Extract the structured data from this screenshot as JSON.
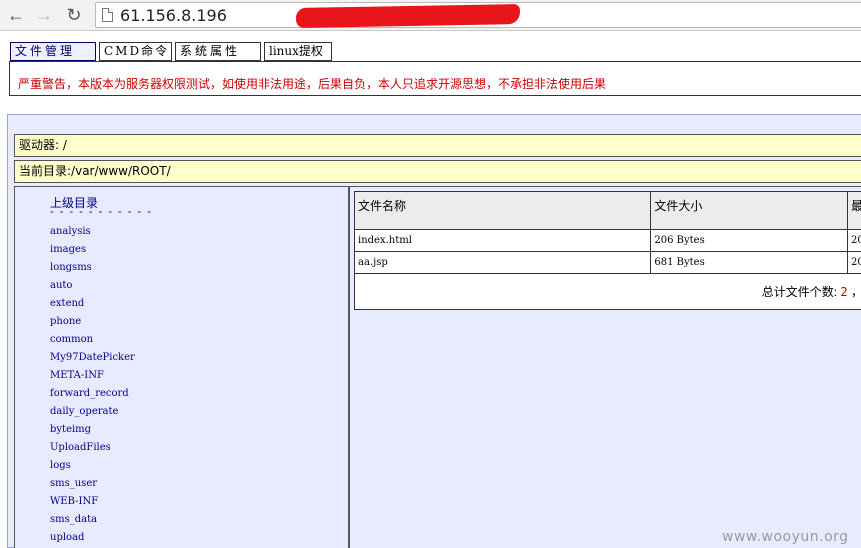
{
  "browser": {
    "url": "61.156.8.196"
  },
  "tabs": [
    {
      "label": "文件管理"
    },
    {
      "label": "CMD命令"
    },
    {
      "label": "系统属性"
    },
    {
      "label": "linux提权"
    }
  ],
  "warning": "严重警告，本版本为服务器权限测试，如使用非法用途，后果自负，本人只追求开源思想，不承担非法使用后果",
  "drive": "驱动器: /",
  "current_dir": "当前目录:/var/www/ROOT/",
  "sidebar": {
    "parent_label": "上级目录",
    "dashes": "- - - - - - - - - - -",
    "dirs": [
      "analysis",
      "images",
      "longsms",
      "auto",
      "extend",
      "phone",
      "common",
      "My97DatePicker",
      "META-INF",
      "forward_record",
      "daily_operate",
      "byteimg",
      "UploadFiles",
      "logs",
      "sms_user",
      "WEB-INF",
      "sms_data",
      "upload"
    ]
  },
  "filetable": {
    "headers": [
      "文件名称",
      "文件大小",
      "最"
    ],
    "rows": [
      [
        "index.html",
        "206 Bytes",
        "20"
      ],
      [
        "aa.jsp",
        "681 Bytes",
        "20"
      ]
    ],
    "total_label": "总计文件个数:",
    "total_count": "2",
    "total_sep": "，"
  },
  "watermark": "www.wooyun.org"
}
